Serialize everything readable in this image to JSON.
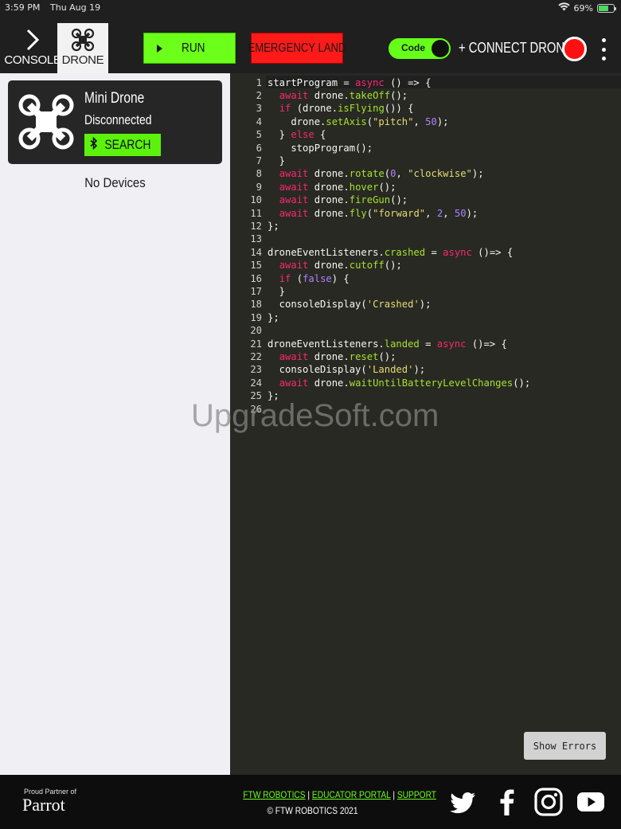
{
  "status_bar": {
    "time": "3:59 PM",
    "date": "Thu Aug 19",
    "battery": "69%"
  },
  "toolbar": {
    "tab_console": "CONSOLE",
    "tab_drone": "DRONE",
    "run_label": "RUN",
    "emergency_label": "EMERGENCY LAND",
    "mode_toggle_label": "Code",
    "connect_label": "+ CONNECT DRONE"
  },
  "device_card": {
    "name": "Mini Drone",
    "status": "Disconnected",
    "search_label": "SEARCH"
  },
  "devices_empty": "No Devices",
  "editor": {
    "lines": [
      "startProgram = async () => {",
      "  await drone.takeOff();",
      "  if (drone.isFlying()) {",
      "    drone.setAxis(\"pitch\", 50);",
      "  } else {",
      "    stopProgram();",
      "  }",
      "  await drone.rotate(0, \"clockwise\");",
      "  await drone.hover();",
      "  await drone.fireGun();",
      "  await drone.fly(\"forward\", 2, 50);",
      "};",
      "",
      "droneEventListeners.crashed = async ()=> {",
      "  await drone.cutoff();",
      "  if (false) {",
      "  }",
      "  consoleDisplay('Crashed');",
      "};",
      "",
      "droneEventListeners.landed = async ()=> {",
      "  await drone.reset();",
      "  consoleDisplay('Landed');",
      "  await drone.waitUntilBatteryLevelChanges();",
      "};",
      ""
    ],
    "show_errors_label": "Show Errors",
    "watermark": "UpgradeSoft.com"
  },
  "footer": {
    "partner_small": "Proud Partner of",
    "partner_brand": "Parrot",
    "link_1": "FTW ROBOTICS",
    "link_2": "EDUCATOR PORTAL",
    "link_3": "SUPPORT",
    "separator": "|",
    "copyright": "© FTW ROBOTICS 2021",
    "social_icons": [
      "twitter-icon",
      "facebook-icon",
      "instagram-icon",
      "youtube-icon"
    ]
  },
  "colors": {
    "accent_green": "#6cff1a",
    "emergency_red": "#ff1a1a",
    "editor_bg": "#282923",
    "keyword": "#f92672",
    "function": "#a6e22e",
    "string": "#e6db74",
    "number": "#ae81ff"
  }
}
